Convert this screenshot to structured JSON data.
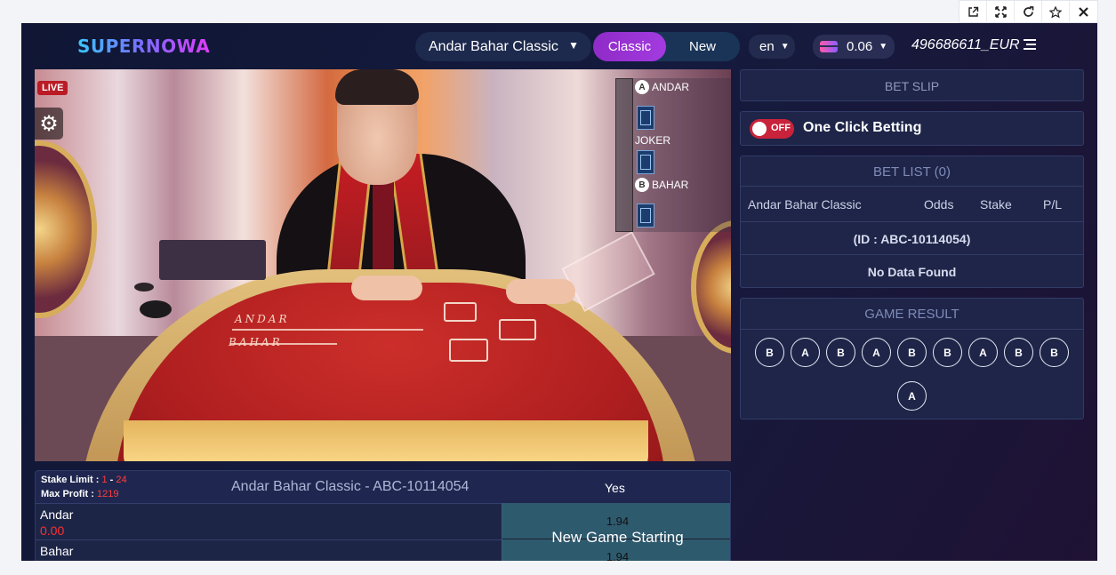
{
  "toolbar": {
    "icons": [
      "external-link-icon",
      "expand-icon",
      "refresh-icon",
      "star-icon",
      "close-icon"
    ]
  },
  "header": {
    "logo": "SUPERNOWA",
    "game_select": "Andar Bahar Classic",
    "modes": [
      "Classic",
      "New"
    ],
    "active_mode": "Classic",
    "language": "en",
    "balance": "0.06",
    "user_id": "496686611_EUR"
  },
  "video": {
    "live_badge": "LIVE",
    "felt_top": "ANDAR",
    "felt_bottom": "BAHAR",
    "card_panel": {
      "andar_letter": "A",
      "andar_label": "ANDAR",
      "joker_label": "JOKER",
      "bahar_letter": "B",
      "bahar_label": "BAHAR"
    }
  },
  "bet_table": {
    "stake_limit_label": "Stake Limit :",
    "stake_limit_min": "1",
    "stake_limit_sep": " - ",
    "stake_limit_max": "24",
    "max_profit_label": "Max Profit :",
    "max_profit_value": "1219",
    "title": "Andar Bahar Classic - ABC-10114054",
    "yes_header": "Yes",
    "rows": [
      {
        "name": "Andar",
        "pl": "0.00",
        "odds": "1.94"
      },
      {
        "name": "Bahar",
        "pl": "",
        "odds": "1.94"
      }
    ],
    "status": "New Game Starting"
  },
  "bet_slip": {
    "title": "BET SLIP"
  },
  "one_click": {
    "toggle": "OFF",
    "label": "One Click Betting"
  },
  "bet_list": {
    "title": "BET LIST (0)",
    "columns": [
      "Andar Bahar Classic",
      "Odds",
      "Stake",
      "P/L"
    ],
    "id_row": "(ID : ABC-10114054)",
    "empty": "No Data Found"
  },
  "game_result": {
    "title": "GAME RESULT",
    "results": [
      "B",
      "A",
      "B",
      "A",
      "B",
      "B",
      "A",
      "B",
      "B",
      "A"
    ]
  },
  "colors": {
    "accent_purple": "#a33be0",
    "toggle_red": "#c9233b",
    "stake_red": "#ff3d3d",
    "suspended_bg": "#2e5a6e"
  }
}
